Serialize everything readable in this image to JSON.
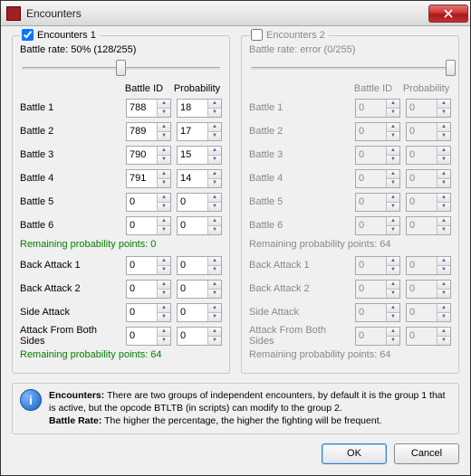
{
  "window": {
    "title": "Encounters"
  },
  "group1": {
    "checked": true,
    "label": "Encounters 1",
    "rate_line": "Battle rate: 50% (128/255)",
    "slider_pct": 50,
    "col_id": "Battle ID",
    "col_prob": "Probability",
    "battles": [
      {
        "label": "Battle 1",
        "id": "788",
        "prob": "18"
      },
      {
        "label": "Battle 2",
        "id": "789",
        "prob": "17"
      },
      {
        "label": "Battle 3",
        "id": "790",
        "prob": "15"
      },
      {
        "label": "Battle 4",
        "id": "791",
        "prob": "14"
      },
      {
        "label": "Battle 5",
        "id": "0",
        "prob": "0"
      },
      {
        "label": "Battle 6",
        "id": "0",
        "prob": "0"
      }
    ],
    "remain1": "Remaining probability points: 0",
    "extras": [
      {
        "label": "Back Attack 1",
        "id": "0",
        "prob": "0"
      },
      {
        "label": "Back Attack 2",
        "id": "0",
        "prob": "0"
      },
      {
        "label": "Side Attack",
        "id": "0",
        "prob": "0"
      },
      {
        "label": "Attack From Both Sides",
        "id": "0",
        "prob": "0"
      }
    ],
    "remain2": "Remaining probability points: 64"
  },
  "group2": {
    "checked": false,
    "label": "Encounters 2",
    "rate_line": "Battle rate: error (0/255)",
    "slider_pct": 100,
    "col_id": "Battle ID",
    "col_prob": "Probability",
    "battles": [
      {
        "label": "Battle 1",
        "id": "0",
        "prob": "0"
      },
      {
        "label": "Battle 2",
        "id": "0",
        "prob": "0"
      },
      {
        "label": "Battle 3",
        "id": "0",
        "prob": "0"
      },
      {
        "label": "Battle 4",
        "id": "0",
        "prob": "0"
      },
      {
        "label": "Battle 5",
        "id": "0",
        "prob": "0"
      },
      {
        "label": "Battle 6",
        "id": "0",
        "prob": "0"
      }
    ],
    "remain1": "Remaining probability points: 64",
    "extras": [
      {
        "label": "Back Attack 1",
        "id": "0",
        "prob": "0"
      },
      {
        "label": "Back Attack 2",
        "id": "0",
        "prob": "0"
      },
      {
        "label": "Side Attack",
        "id": "0",
        "prob": "0"
      },
      {
        "label": "Attack From Both Sides",
        "id": "0",
        "prob": "0"
      }
    ],
    "remain2": "Remaining probability points: 64"
  },
  "info": {
    "line1a": "Encounters:",
    "line1b": " There are two groups of independent encounters, by default it is the group 1 that is active, but the opcode BTLTB (in scripts) can modify to the group 2.",
    "line2a": "Battle Rate:",
    "line2b": " The higher the percentage, the higher the fighting will be frequent."
  },
  "buttons": {
    "ok": "OK",
    "cancel": "Cancel"
  }
}
